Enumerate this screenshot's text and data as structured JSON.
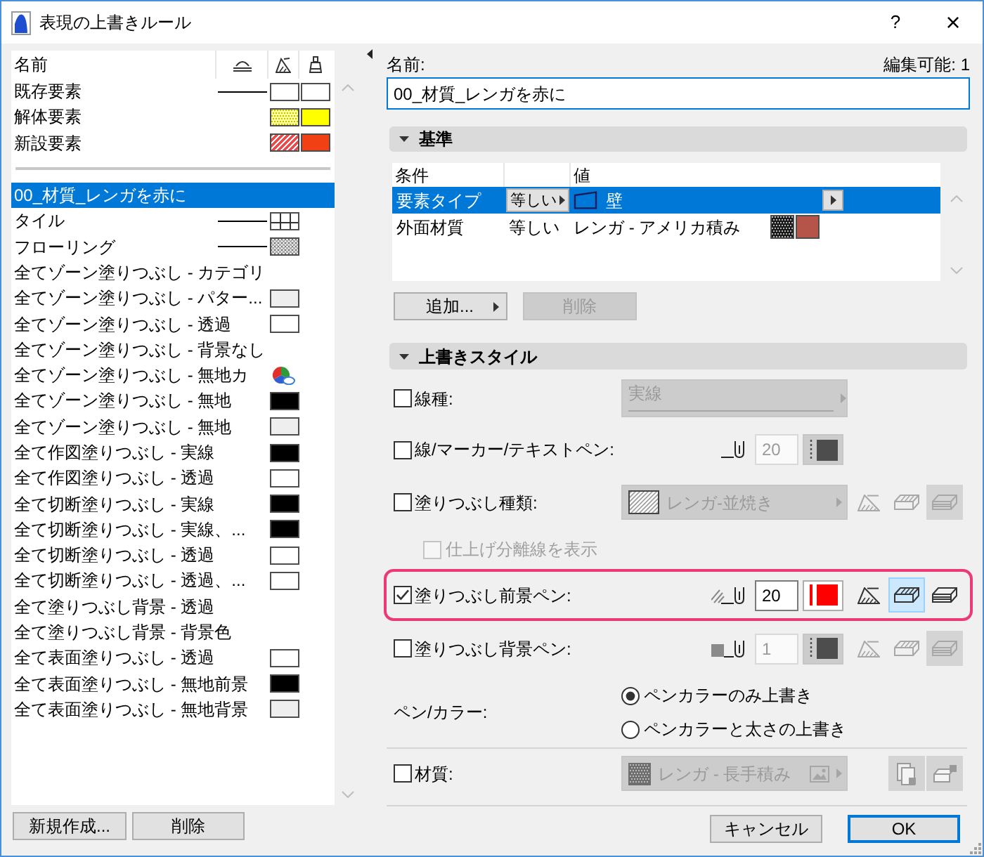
{
  "window": {
    "title": "表現の上書きルール",
    "help": "?",
    "close": "×"
  },
  "rule_list": {
    "header": "名前",
    "fixed_items": [
      {
        "name": "既存要素",
        "selected": false,
        "line": true,
        "swatches": [
          {
            "kind": "empty"
          },
          {
            "kind": "empty"
          }
        ]
      },
      {
        "name": "解体要素",
        "selected": false,
        "line": false,
        "swatches": [
          {
            "kind": "dotted",
            "color": "#ffff99"
          },
          {
            "kind": "solid",
            "color": "#ffff00"
          }
        ]
      },
      {
        "name": "新設要素",
        "selected": false,
        "line": false,
        "swatches": [
          {
            "kind": "hatched",
            "color": "#f04848"
          },
          {
            "kind": "solid",
            "color": "#f04014"
          }
        ]
      }
    ],
    "items": [
      {
        "name": "00_材質_レンガを赤に",
        "selected": true,
        "line": false
      },
      {
        "name": "タイル",
        "selected": false,
        "line": true,
        "swatches": [
          {
            "kind": "grid"
          }
        ]
      },
      {
        "name": "フローリング",
        "selected": false,
        "line": true,
        "swatches": [
          {
            "kind": "crosshatch",
            "color": "#e4e4e4"
          }
        ]
      },
      {
        "name": "全てゾーン塗りつぶし - カテゴリ",
        "selected": false,
        "line": false
      },
      {
        "name": "全てゾーン塗りつぶし - パター...",
        "selected": false,
        "line": false,
        "swatches": [
          {
            "kind": "solid",
            "color": "#eeeeee"
          }
        ]
      },
      {
        "name": "全てゾーン塗りつぶし - 透過",
        "selected": false,
        "line": false,
        "swatches": [
          {
            "kind": "empty"
          }
        ]
      },
      {
        "name": "全てゾーン塗りつぶし - 背景なし",
        "selected": false,
        "line": false
      },
      {
        "name": "全てゾーン塗りつぶし - 無地カ",
        "selected": false,
        "line": false,
        "swatches": [
          {
            "kind": "palette"
          }
        ]
      },
      {
        "name": "全てゾーン塗りつぶし - 無地",
        "selected": false,
        "line": false,
        "swatches": [
          {
            "kind": "solid",
            "color": "#000000"
          }
        ]
      },
      {
        "name": "全てゾーン塗りつぶし - 無地",
        "selected": false,
        "line": false,
        "swatches": [
          {
            "kind": "solid",
            "color": "#eeeeee"
          }
        ]
      },
      {
        "name": "全て作図塗りつぶし - 実線",
        "selected": false,
        "line": false,
        "swatches": [
          {
            "kind": "solid",
            "color": "#000000"
          }
        ]
      },
      {
        "name": "全て作図塗りつぶし - 透過",
        "selected": false,
        "line": false,
        "swatches": [
          {
            "kind": "empty"
          }
        ]
      },
      {
        "name": "全て切断塗りつぶし - 実線",
        "selected": false,
        "line": false,
        "swatches": [
          {
            "kind": "solid",
            "color": "#000000"
          }
        ]
      },
      {
        "name": "全て切断塗りつぶし - 実線、...",
        "selected": false,
        "line": false,
        "swatches": [
          {
            "kind": "solid",
            "color": "#000000"
          }
        ]
      },
      {
        "name": "全て切断塗りつぶし - 透過",
        "selected": false,
        "line": false,
        "swatches": [
          {
            "kind": "empty"
          }
        ]
      },
      {
        "name": "全て切断塗りつぶし - 透過、...",
        "selected": false,
        "line": false,
        "swatches": [
          {
            "kind": "empty"
          }
        ]
      },
      {
        "name": "全て塗りつぶし背景 - 透過",
        "selected": false,
        "line": false
      },
      {
        "name": "全て塗りつぶし背景 - 背景色",
        "selected": false,
        "line": false
      },
      {
        "name": "全て表面塗りつぶし - 透過",
        "selected": false,
        "line": false,
        "swatches": [
          {
            "kind": "empty"
          }
        ]
      },
      {
        "name": "全て表面塗りつぶし - 無地前景",
        "selected": false,
        "line": false,
        "swatches": [
          {
            "kind": "solid",
            "color": "#000000"
          }
        ]
      },
      {
        "name": "全て表面塗りつぶし - 無地背景",
        "selected": false,
        "line": false,
        "swatches": [
          {
            "kind": "solid",
            "color": "#eeeeee"
          }
        ]
      }
    ],
    "buttons": [
      "新規作成...",
      "削除"
    ]
  },
  "editor": {
    "name_label": "名前:",
    "edit_count": "編集可能: 1",
    "name_value": "00_材質_レンガを赤に",
    "criteria": {
      "title": "基準",
      "expanded": true,
      "headers": {
        "condition": "条件",
        "value": "値"
      },
      "rows": [
        {
          "kind": "element",
          "condition": "要素タイプ",
          "operator": "等しい",
          "value": "壁",
          "selected": true
        },
        {
          "kind": "material",
          "condition": "外面材質",
          "operator": "等しい",
          "value": "レンガ - アメリカ積み",
          "selected": false,
          "swatches": [
            {
              "kind": "dotted",
              "color": "#1a1a1a"
            },
            {
              "kind": "solid",
              "color": "#b5554a"
            }
          ]
        }
      ],
      "add_button": "追加...",
      "delete_button": {
        "label": "削除",
        "disabled": true
      }
    },
    "override_style": {
      "title": "上書きスタイル",
      "expanded": true,
      "rows": [
        {
          "kind": "linetype",
          "label": "線種:",
          "checked": false,
          "highlighted": false,
          "value": "実線"
        },
        {
          "kind": "linepen",
          "label": "線/マーカー/テキストペン:",
          "checked": false,
          "highlighted": false,
          "pen": "20",
          "color": "#4d4d4d"
        },
        {
          "kind": "filltype",
          "label": "塗りつぶし種類:",
          "checked": false,
          "highlighted": false,
          "value": "レンガ-並焼き",
          "modes": [
            {
              "selected": false
            },
            {
              "selected": false
            },
            {
              "selected": true
            }
          ]
        },
        {
          "kind": "option",
          "label": "仕上げ分離線を表示",
          "checked": false,
          "highlighted": false,
          "disabled": true
        },
        {
          "kind": "forepen",
          "label": "塗りつぶし前景ペン:",
          "checked": true,
          "highlighted": true,
          "pen": "20",
          "color": "#ff0000",
          "modes": [
            {
              "selected": false
            },
            {
              "selected": true
            },
            {
              "selected": false
            }
          ]
        },
        {
          "kind": "backpen",
          "label": "塗りつぶし背景ペン:",
          "checked": false,
          "highlighted": false,
          "pen": "1",
          "color": "#4d4d4d",
          "modes": [
            {
              "selected": false
            },
            {
              "selected": false
            },
            {
              "selected": true
            }
          ]
        },
        {
          "kind": "radios",
          "label": "ペン/カラー:",
          "highlighted": false,
          "options": [
            {
              "label": "ペンカラーのみ上書き",
              "selected": true
            },
            {
              "label": "ペンカラーと太さの上書き",
              "selected": false
            }
          ]
        },
        {
          "kind": "material",
          "label": "材質:",
          "checked": false,
          "highlighted": false,
          "value": "レンガ - 長手積み"
        }
      ]
    },
    "buttons": [
      {
        "label": "キャンセル",
        "default": false
      },
      {
        "label": "OK",
        "default": true
      }
    ]
  }
}
